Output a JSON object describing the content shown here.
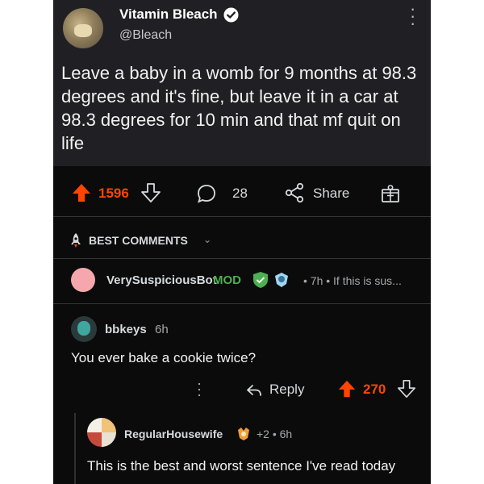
{
  "tweet": {
    "name": "Vitamin Bleach",
    "handle": "@Bleach",
    "text": "Leave a baby in a womb for 9 months at 98.3 degrees and it's fine, but leave it in a car at 98.3 degrees for 10 min and that mf quit on life"
  },
  "post_actions": {
    "upvotes": "1596",
    "comments": "28",
    "share_label": "Share"
  },
  "sort": {
    "label": "BEST COMMENTS"
  },
  "mod_comment": {
    "author": "VerySuspiciousBot",
    "badge": "MOD",
    "meta": "• 7h • If this is sus..."
  },
  "comment1": {
    "author": "bbkeys",
    "time": "6h",
    "text": "You ever bake a cookie twice?",
    "reply_label": "Reply",
    "votes": "270"
  },
  "comment2": {
    "author": "RegularHousewife",
    "meta": "+2 • 6h",
    "text": "This is the best and worst sentence I've read today"
  },
  "colors": {
    "upvote": "#ff4500",
    "mod": "#4caf50",
    "verified": "#1d9bf0"
  },
  "icons": [
    "verified-badge-icon",
    "more-dots-icon",
    "upvote-arrow-icon",
    "downvote-arrow-icon",
    "comment-bubble-icon",
    "share-icon",
    "award-gift-icon",
    "rocket-sort-icon",
    "shield-icon",
    "reply-arrow-icon"
  ]
}
